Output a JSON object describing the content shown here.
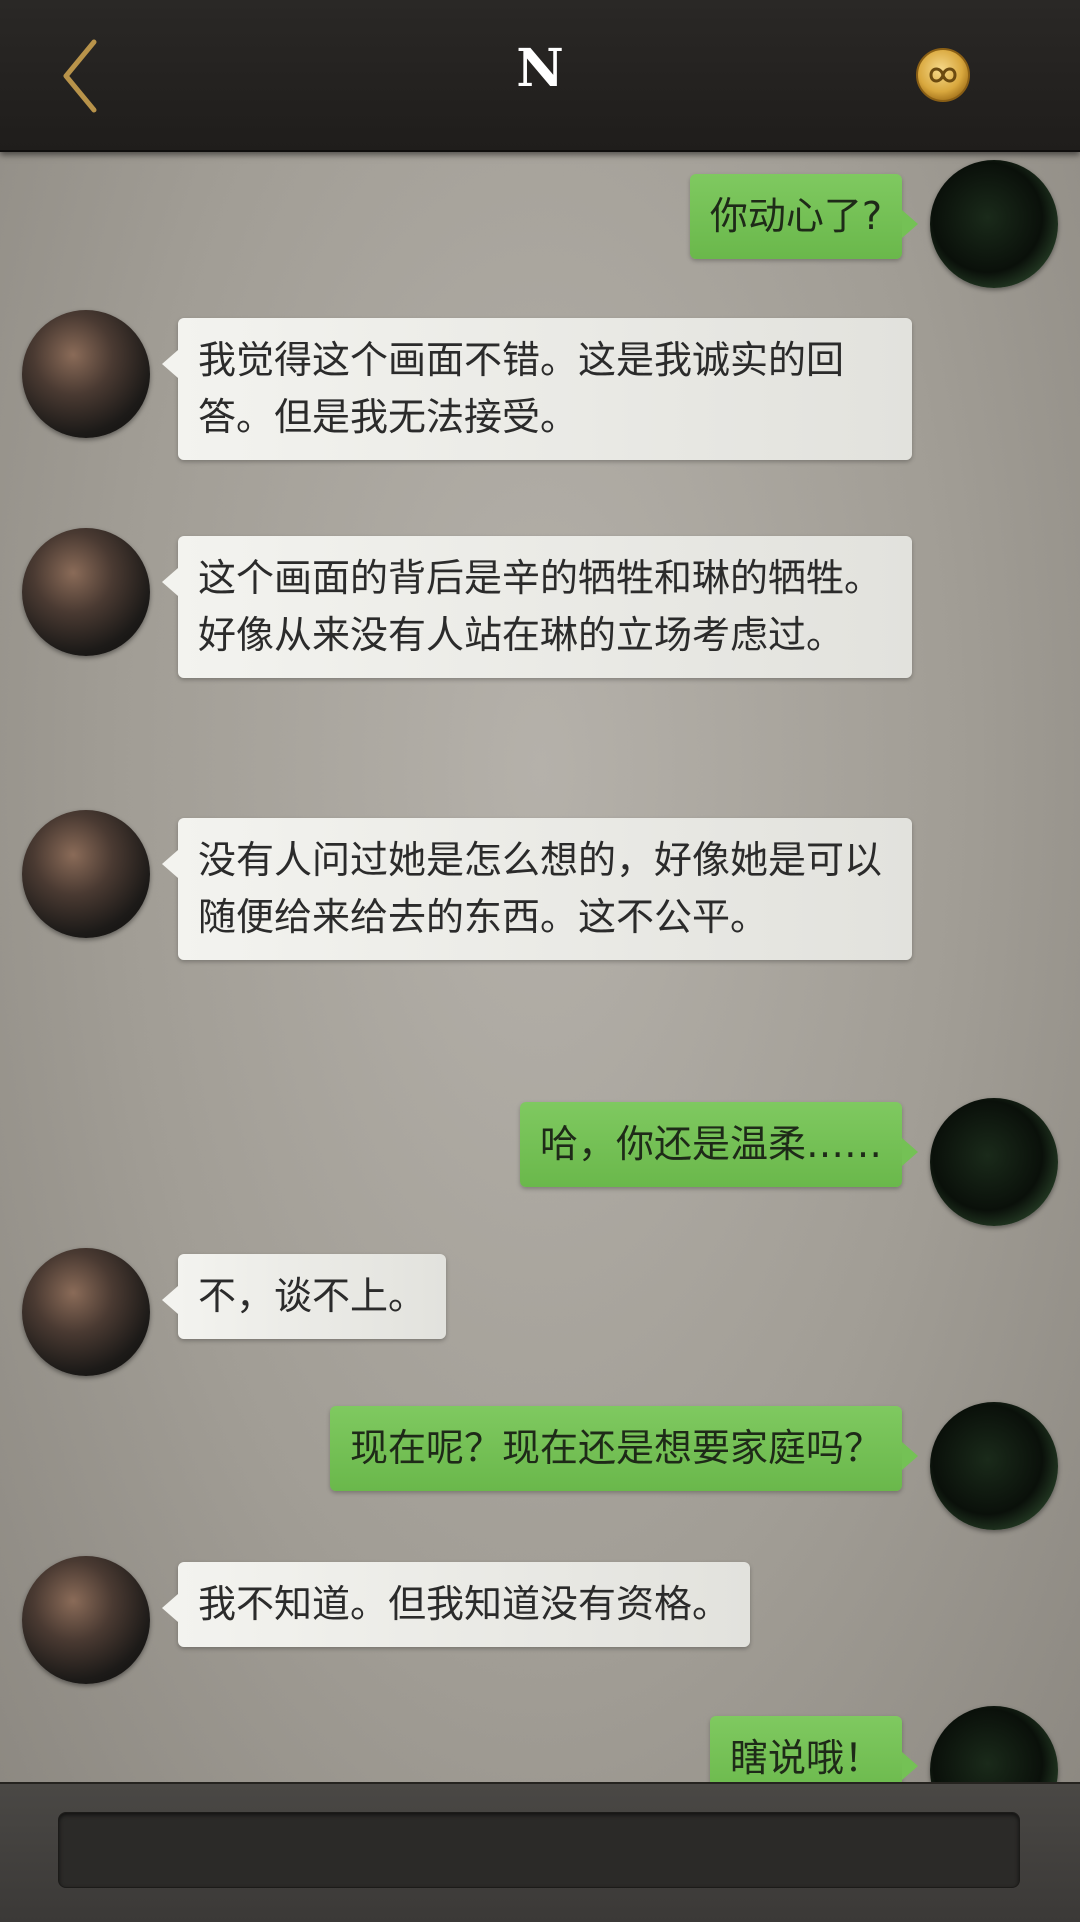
{
  "header": {
    "title": "N",
    "accent_color": "#b8934a",
    "back_icon": "chevron-left-icon",
    "coin_icon": "infinity-coin-icon"
  },
  "messages": [
    {
      "side": "right",
      "text": "你动心了?"
    },
    {
      "side": "left",
      "text": "我觉得这个画面不错。这是我诚实的回答。但是我无法接受。"
    },
    {
      "side": "left",
      "text": "这个画面的背后是辛的牺牲和琳的牺牲。好像从来没有人站在琳的立场考虑过。"
    },
    {
      "side": "left",
      "text": "没有人问过她是怎么想的，好像她是可以随便给来给去的东西。这不公平。"
    },
    {
      "side": "right",
      "text": "哈，你还是温柔……"
    },
    {
      "side": "left",
      "text": "不，谈不上。"
    },
    {
      "side": "right",
      "text": "现在呢？现在还是想要家庭吗？"
    },
    {
      "side": "left",
      "text": "我不知道。但我知道没有资格。"
    },
    {
      "side": "right",
      "text": "瞎说哦！"
    }
  ],
  "input": {
    "value": "",
    "placeholder": ""
  },
  "colors": {
    "sent_bubble": "#74c155",
    "received_bubble": "#eeeeea",
    "header_bg": "#232120"
  }
}
